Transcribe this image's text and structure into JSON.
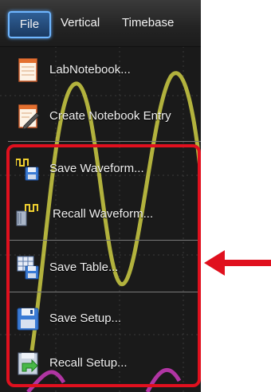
{
  "menubar": {
    "tabs": [
      {
        "label": "File",
        "active": true
      },
      {
        "label": "Vertical",
        "active": false
      },
      {
        "label": "Timebase",
        "active": false
      }
    ]
  },
  "menu": {
    "items": [
      {
        "label": "LabNotebook...",
        "icon": "notebook-icon"
      },
      {
        "label": "Create Notebook Entry",
        "icon": "create-notebook-entry-icon"
      },
      {
        "label": "Save Waveform...",
        "icon": "save-waveform-icon"
      },
      {
        "label": "Recall Waveform...",
        "icon": "recall-waveform-icon"
      },
      {
        "label": "Save Table...",
        "icon": "save-table-icon"
      },
      {
        "label": "Save Setup...",
        "icon": "save-setup-icon"
      },
      {
        "label": "Recall Setup...",
        "icon": "recall-setup-icon"
      }
    ]
  },
  "colors": {
    "highlight": "#e0101e",
    "active_tab": "#2f5f96",
    "trace_yellow": "#e6e64a",
    "trace_magenta": "#d63cc6"
  }
}
